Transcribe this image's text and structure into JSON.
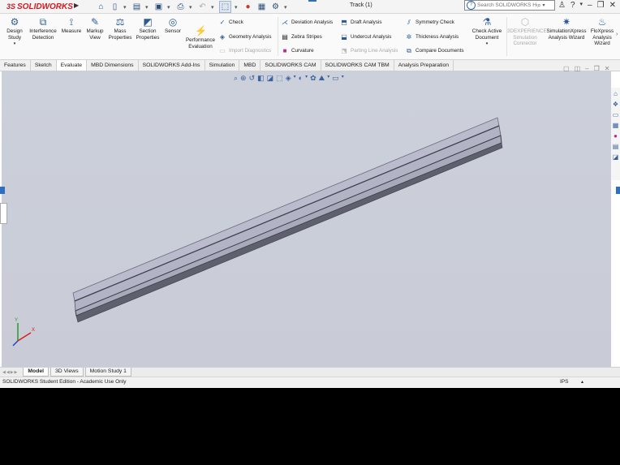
{
  "app": {
    "brand_prefix": "3S",
    "brand": "SOLIDWORKS",
    "document_title": "Track (1)"
  },
  "search": {
    "placeholder": "Search SOLIDWORKS Help",
    "help_icon_text": "?"
  },
  "ribbon": {
    "large_buttons": [
      {
        "label1": "Design",
        "label2": "Study",
        "icon": "design-study-icon"
      },
      {
        "label1": "Interference",
        "label2": "Detection",
        "icon": "interference-icon"
      },
      {
        "label1": "Measure",
        "label2": "",
        "icon": "measure-icon"
      },
      {
        "label1": "Markup",
        "label2": "View",
        "icon": "markup-icon"
      },
      {
        "label1": "Mass",
        "label2": "Properties",
        "icon": "mass-icon"
      },
      {
        "label1": "Section",
        "label2": "Properties",
        "icon": "section-icon"
      },
      {
        "label1": "Sensor",
        "label2": "",
        "icon": "sensor-icon"
      },
      {
        "label1": "Performance",
        "label2": "Evaluation",
        "icon": "performance-icon"
      }
    ],
    "col_check": [
      "Check",
      "Geometry Analysis",
      "Import Diagnostics"
    ],
    "col_deviation": [
      "Deviation Analysis",
      "Zebra Stripes",
      "Curvature"
    ],
    "col_draft": [
      "Draft Analysis",
      "Undercut Analysis",
      "Parting Line Analysis"
    ],
    "col_symmetry": [
      "Symmetry Check",
      "Thickness Analysis",
      "Compare Documents"
    ],
    "check_active": {
      "label1": "Check Active",
      "label2": "Document"
    },
    "threedx": {
      "label1": "3DEXPERIENCE",
      "label2": "Simulation",
      "label3": "Connector"
    },
    "simxpress": {
      "label1": "SimulationXpress",
      "label2": "Analysis Wizard"
    },
    "floxpress": {
      "label1": "FloXpress",
      "label2": "Analysis",
      "label3": "Wizard"
    }
  },
  "tabs": [
    "Features",
    "Sketch",
    "Evaluate",
    "MBD Dimensions",
    "SOLIDWORKS Add-Ins",
    "Simulation",
    "MBD",
    "SOLIDWORKS CAM",
    "SOLIDWORKS CAM TBM",
    "Analysis Preparation"
  ],
  "bottom_tabs": [
    "Model",
    "3D Views",
    "Motion Study 1"
  ],
  "status": {
    "text": "SOLIDWORKS Student Edition - Academic Use Only",
    "units": "IPS"
  },
  "triad": {
    "x": "X",
    "y": "Y"
  },
  "colors": {
    "viewport_bg": "#cbcfd9",
    "part_top": "#b9bacb",
    "part_side": "#646674",
    "accent": "#2f6fc0"
  }
}
